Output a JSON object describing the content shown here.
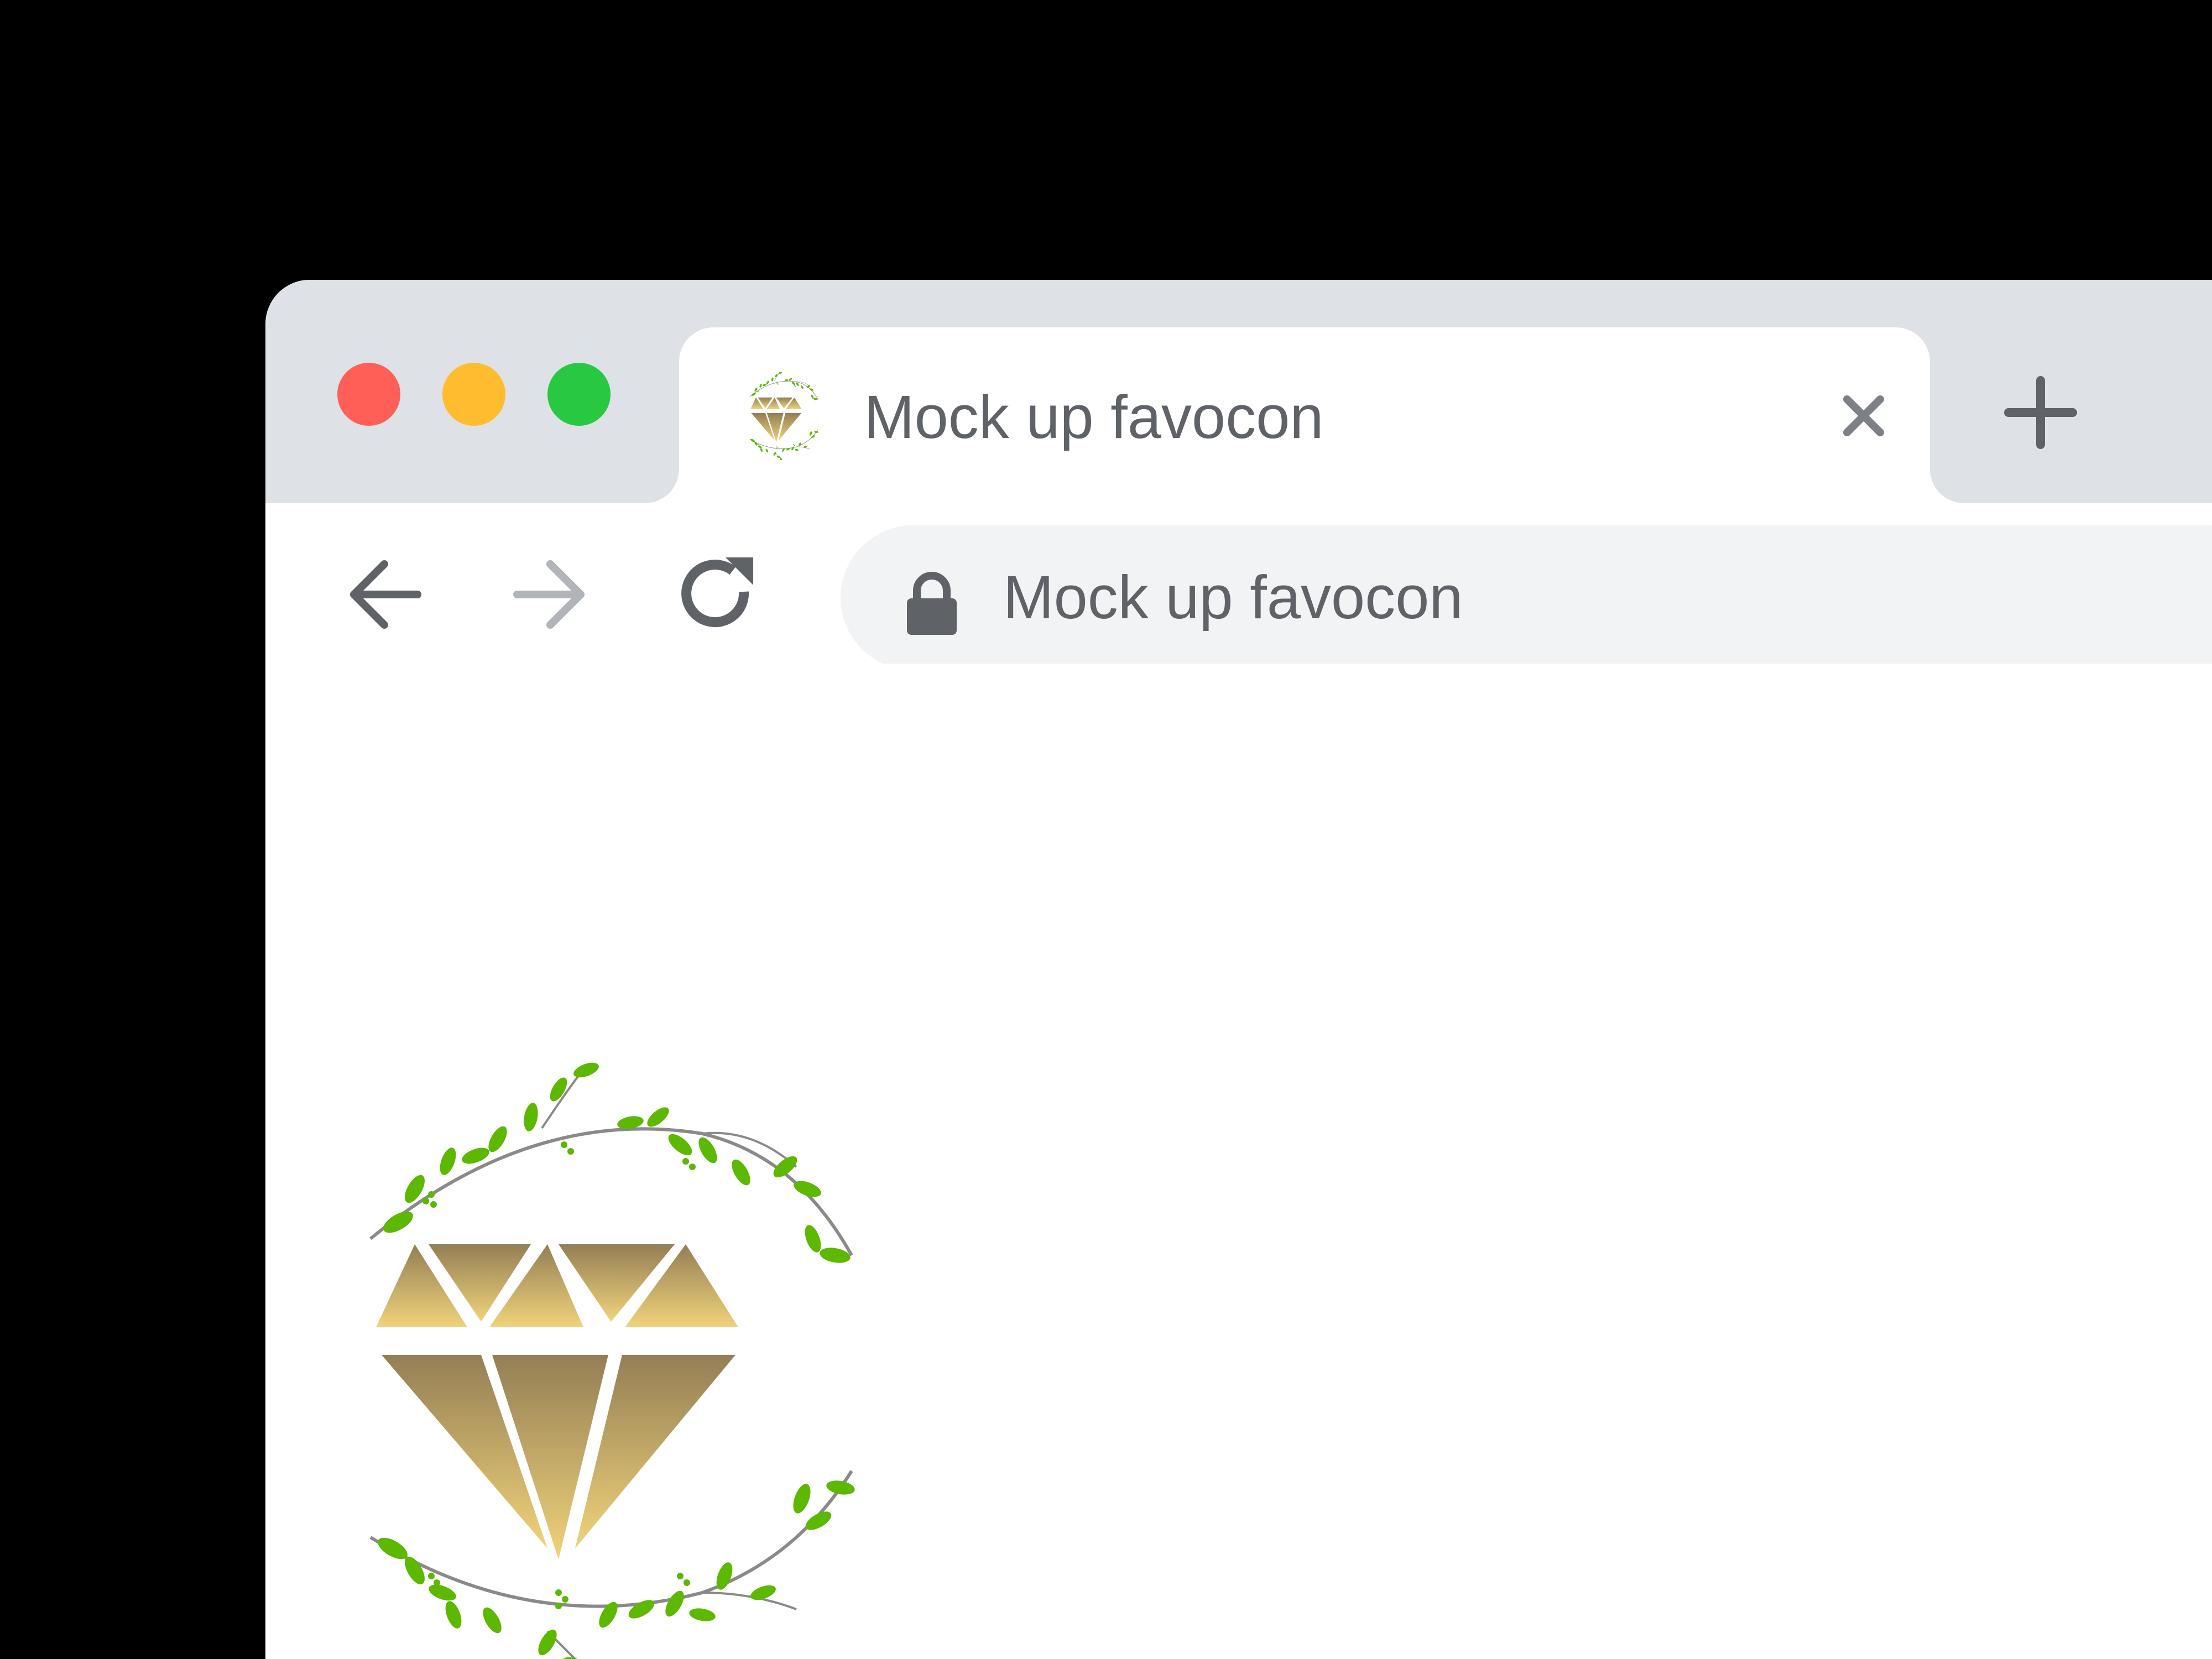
{
  "window": {
    "controls": [
      "close",
      "minimize",
      "maximize"
    ]
  },
  "tab": {
    "title": "Mock up favocon",
    "favicon": "diamond-leaves-logo",
    "close_icon": "close-icon"
  },
  "new_tab": {
    "icon": "plus-icon"
  },
  "toolbar": {
    "back_icon": "arrow-left-icon",
    "forward_icon": "arrow-right-icon",
    "reload_icon": "reload-icon"
  },
  "omnibox": {
    "lock_icon": "lock-icon",
    "text": "Mock up favocon"
  },
  "page": {
    "logo": "diamond-leaves-logo"
  },
  "colors": {
    "tabstrip_bg": "#dee1e6",
    "omnibox_bg": "#f1f3f4",
    "text": "#5f6368",
    "traffic_red": "#ff5f57",
    "traffic_yellow": "#febc2e",
    "traffic_green": "#28c840",
    "diamond_top": "#947e55",
    "diamond_bottom_light": "#f0d37a",
    "leaf_green": "#5cb800"
  }
}
